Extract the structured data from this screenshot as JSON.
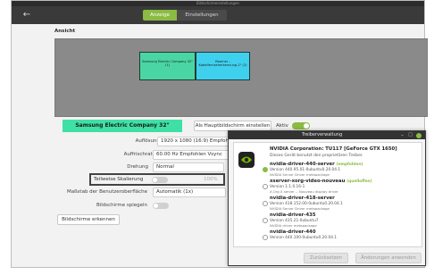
{
  "displays_window": {
    "title": "Bildschirmeinstellungen",
    "tabs": [
      "Anzeige",
      "Einstellungen"
    ],
    "section_heading": "Ansicht",
    "monitors": [
      {
        "label": "Samsung Electric Company 32\" (1)",
        "color": "#4ad6a4"
      },
      {
        "label": "Beamer - Kabelfernseherkennung 2\" (2)",
        "color": "#3fd0ee"
      }
    ],
    "selected_monitor": "Samsung Electric Company 32\"",
    "primary_button": "Als Hauptbildschirm einstellen",
    "active_label": "Aktiv",
    "active_on": true,
    "resolution_label": "Auflösung",
    "resolution_value": "1920 x 1080 (16:9)  Empfohlen",
    "refresh_label": "Auffrischrate",
    "refresh_value": "60.00 Hz  Empfohlen  Vsync",
    "rotation_label": "Drehung",
    "rotation_value": "Normal",
    "fractional_label": "Teilweise Skalierung",
    "fractional_value": "100%",
    "ui_scale_label": "Maßstab der Benutzeroberfläche",
    "ui_scale_value": "Automatik (1x)",
    "mirror_label": "Bildschirme spiegeln",
    "identify_button": "Bildschirme erkennen"
  },
  "driver_window": {
    "title": "Treiberverwaltung",
    "controls": {
      "minimize": "–",
      "maximize": "□"
    },
    "device_name": "NVIDIA Corporation: TU117 [GeForce GTX 1650]",
    "device_desc": "Dieses Gerät benutzt den proprietären Treiber.",
    "drivers": [
      {
        "name": "nvidia-driver-440-server",
        "tag": "(empfohlen)",
        "version": "Version 440.95.01-0ubuntu0.20.04.1",
        "source": "NVIDIA Server Driver metapackage",
        "selected": true
      },
      {
        "name": "xserver-xorg-video-nouveau",
        "tag": "(quelloffen)",
        "version": "Version 1:1.0.16-1",
        "source": "X.Org X server -- Nouveau display driver",
        "selected": false
      },
      {
        "name": "nvidia-driver-418-server",
        "tag": "",
        "version": "Version 418.152.00-0ubuntu0.20.04.1",
        "source": "NVIDIA Server Driver metapackage",
        "selected": false
      },
      {
        "name": "nvidia-driver-435",
        "tag": "",
        "version": "Version 435.21-0ubuntu7",
        "source": "NVIDIA driver metapackage",
        "selected": false
      },
      {
        "name": "nvidia-driver-440",
        "tag": "",
        "version": "Version 440.100-0ubuntu0.20.04.1",
        "source": "",
        "selected": false
      }
    ],
    "revert_button": "Zurücksetzen",
    "apply_button": "Änderungen anwenden"
  },
  "colors": {
    "accent": "#8bbb43",
    "toolbar": "#3a3a3a"
  }
}
